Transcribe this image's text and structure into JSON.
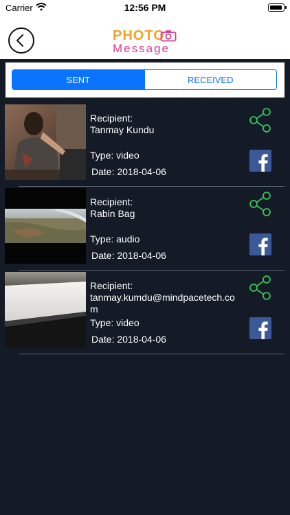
{
  "status": {
    "carrier": "Carrier",
    "time": "12:56 PM"
  },
  "header": {
    "logo_top": "PHOTO",
    "logo_bottom": "Message"
  },
  "tabs": {
    "sent": "SENT",
    "received": "RECEIVED"
  },
  "colors": {
    "accent": "#0a74ff",
    "share": "#34c759",
    "facebook": "#3b5998",
    "background": "#141a26"
  },
  "items": [
    {
      "recipient_label": "Recipient:",
      "recipient": "Tanmay Kundu",
      "type": "Type: video",
      "date": "Date: 2018-04-06"
    },
    {
      "recipient_label": "Recipient:",
      "recipient": "Rabin Bag",
      "type": "Type: audio",
      "date": "Date: 2018-04-06"
    },
    {
      "recipient_label": "Recipient:",
      "recipient": "tanmay.kumdu@mindpacetech.com",
      "type": "Type: video",
      "date": "Date: 2018-04-06"
    }
  ]
}
